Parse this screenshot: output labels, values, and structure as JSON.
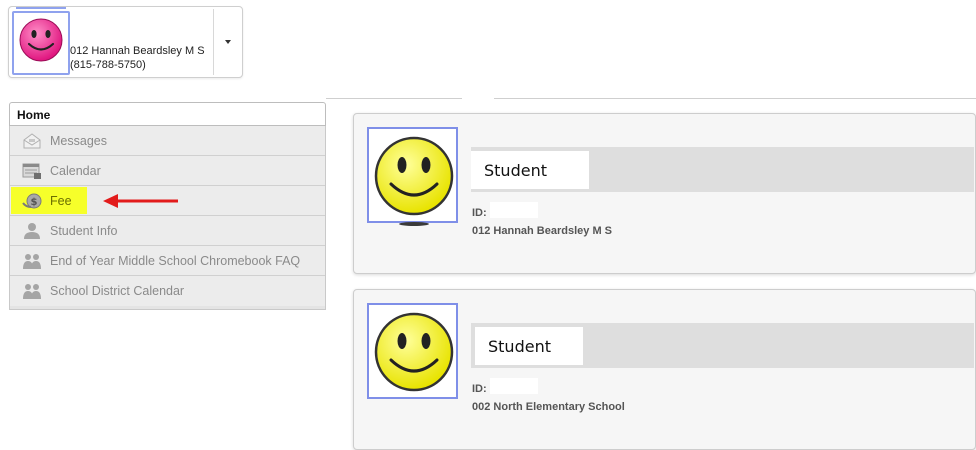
{
  "school_picker": {
    "name": "012 Hannah Beardsley M S",
    "phone": "(815-788-5750)"
  },
  "sidebar": {
    "home_tab": "Home",
    "items": [
      {
        "label": "Messages",
        "icon": "envelope-icon"
      },
      {
        "label": "Calendar",
        "icon": "calendar-icon"
      },
      {
        "label": "Fee",
        "icon": "fee-coin-icon"
      },
      {
        "label": "Student Info",
        "icon": "person-icon"
      },
      {
        "label": "End of Year Middle School Chromebook FAQ",
        "icon": "group-icon"
      },
      {
        "label": "School District Calendar",
        "icon": "group-icon"
      }
    ]
  },
  "annotation": {
    "highlight_color": "#f6ff2a",
    "arrow_color": "#e21b1b"
  },
  "students": [
    {
      "role": "Student",
      "id_label": "ID:",
      "school": "012 Hannah Beardsley M S"
    },
    {
      "role": "Student",
      "id_label": "ID:",
      "school": "002 North Elementary School"
    }
  ]
}
